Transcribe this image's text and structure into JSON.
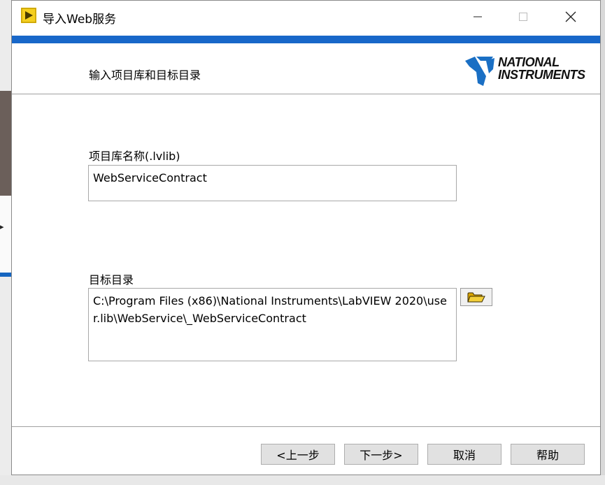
{
  "window": {
    "title": "导入Web服务",
    "controls": {
      "minimize": "minimize-icon",
      "maximize": "maximize-icon",
      "close": "close-icon"
    }
  },
  "header": {
    "title": "输入项目库和目标目录",
    "logo_line1": "NATIONAL",
    "logo_line2": "INSTRUMENTS"
  },
  "form": {
    "library_label": "项目库名称(.lvlib)",
    "library_value": "WebServiceContract",
    "directory_label": "目标目录",
    "directory_value": "C:\\Program Files (x86)\\National Instruments\\LabVIEW 2020\\user.lib\\WebService\\_WebServiceContract",
    "browse_icon": "folder-open-icon"
  },
  "buttons": {
    "back": "<上一步",
    "next": "下一步>",
    "cancel": "取消",
    "help": "帮助"
  },
  "colors": {
    "accent_bar": "#1867c9",
    "logo_blue": "#1a6fc4",
    "folder_yellow": "#e8c23a"
  }
}
